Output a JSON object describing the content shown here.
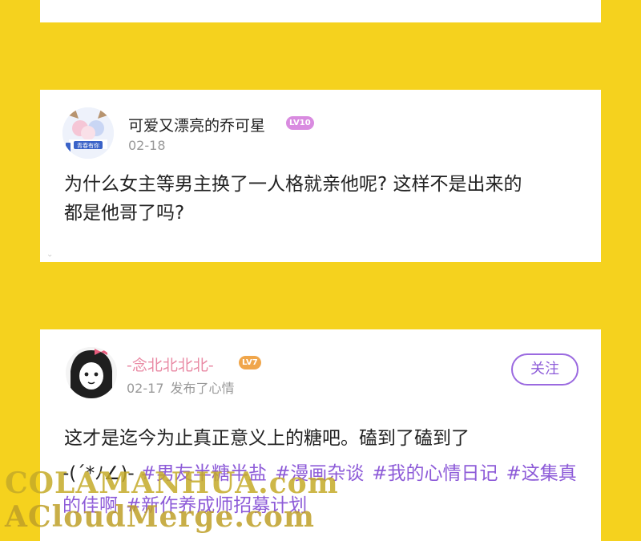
{
  "post1": {
    "username": "可爱又漂亮的乔可星",
    "level": "LV10",
    "avatar_caption": "青春有你",
    "date": "02-18",
    "text_lines": [
      "为什么女主等男主换了一人格就亲他呢? 这样不是出来的",
      "都是他哥了吗?"
    ]
  },
  "post2": {
    "username": "-念北北北北-",
    "level": "LV7",
    "date": "02-17",
    "action": "发布了心情",
    "follow_label": "关注",
    "text": "这才是迄今为止真正意义上的糖吧。磕到了磕到了",
    "emoticon": "-(ˊ*ﾉ∠)-",
    "tags": [
      "#男友半糖半盐",
      "#漫画杂谈",
      "#我的心情日记",
      "#这集真的佳啊",
      "#新作养成师招募计划"
    ]
  },
  "watermarks": {
    "line1": "COLAMANHUA.com",
    "line2": "ACloudMerge.com"
  },
  "colors": {
    "background": "#F5D21E",
    "tag_purple": "#8d5bd8",
    "username_pink": "#e98aa4"
  }
}
